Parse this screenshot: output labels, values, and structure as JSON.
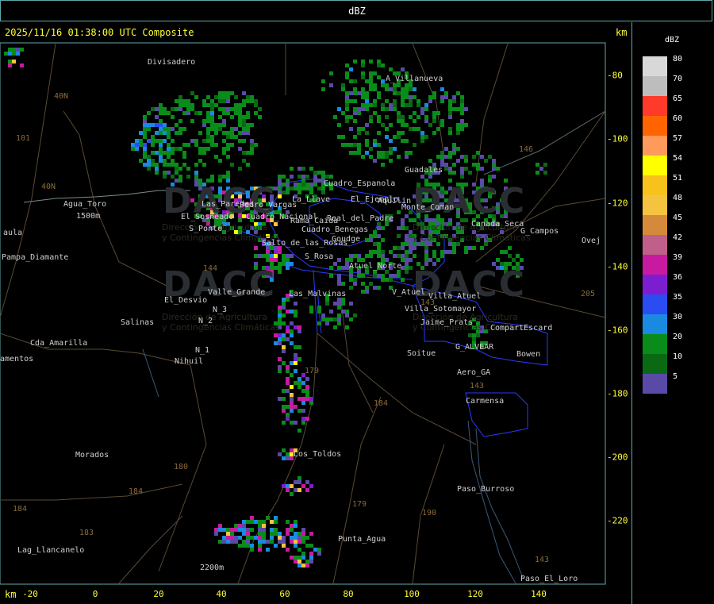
{
  "window": {
    "title": "dBZ"
  },
  "header": {
    "timestamp_label": "2025/11/16 01:38:00 UTC Composite",
    "unit_top": "km",
    "unit_bottom": "km"
  },
  "axes": {
    "x_ticks": [
      "-20",
      "0",
      "20",
      "40",
      "60",
      "80",
      "100",
      "120",
      "140"
    ],
    "y_ticks": [
      "-80",
      "-100",
      "-120",
      "-140",
      "-160",
      "-180",
      "-200",
      "-220"
    ]
  },
  "legend": {
    "title": "dBZ",
    "entries": [
      {
        "label": "80",
        "color": "#d8d8d8"
      },
      {
        "label": "70",
        "color": "#bdbdbd"
      },
      {
        "label": "65",
        "color": "#ff3a2a"
      },
      {
        "label": "60",
        "color": "#ff6400"
      },
      {
        "label": "57",
        "color": "#ff9a5a"
      },
      {
        "label": "54",
        "color": "#ffff00"
      },
      {
        "label": "51",
        "color": "#f8c21c"
      },
      {
        "label": "48",
        "color": "#f4c440"
      },
      {
        "label": "45",
        "color": "#d48a3a"
      },
      {
        "label": "42",
        "color": "#c0608a"
      },
      {
        "label": "39",
        "color": "#c81aa0"
      },
      {
        "label": "36",
        "color": "#7c1ed0"
      },
      {
        "label": "35",
        "color": "#2a4cf0"
      },
      {
        "label": "30",
        "color": "#1a8ae0"
      },
      {
        "label": "20",
        "color": "#0a8c1a"
      },
      {
        "label": "10",
        "color": "#0a6a14"
      },
      {
        "label": "5",
        "color": "#5a4aa8"
      }
    ]
  },
  "places": [
    {
      "label": "Divisadero"
    },
    {
      "label": "A_Villanueva"
    },
    {
      "label": "Guadales"
    },
    {
      "label": "Agua_Toro"
    },
    {
      "label": "1500m"
    },
    {
      "label": "aula"
    },
    {
      "label": "Pampa_Diamante"
    },
    {
      "label": "S_Ponte"
    },
    {
      "label": "S_Rosa"
    },
    {
      "label": "Valle_Grande"
    },
    {
      "label": "El_Desvio"
    },
    {
      "label": "Salinas"
    },
    {
      "label": "N_2"
    },
    {
      "label": "N_1"
    },
    {
      "label": "N_3"
    },
    {
      "label": "Nihuil"
    },
    {
      "label": "Cda_Amarilla"
    },
    {
      "label": "amentos"
    },
    {
      "label": "Morados"
    },
    {
      "label": "Lag_Llancanelo"
    },
    {
      "label": "2200m"
    },
    {
      "label": "Los_Toldos"
    },
    {
      "label": "Punta_Agua"
    },
    {
      "label": "Paso_Burroso"
    },
    {
      "label": "Paso_El_Loro"
    },
    {
      "label": "Carmensa"
    },
    {
      "label": "Bowen"
    },
    {
      "label": "Aero_GA"
    },
    {
      "label": "Soitue"
    },
    {
      "label": "G_ALVEAR"
    },
    {
      "label": "CompartEscard"
    },
    {
      "label": "V_Atuel"
    },
    {
      "label": "Atuel_Norte"
    },
    {
      "label": "G_Campos"
    },
    {
      "label": "Ovej"
    },
    {
      "label": "Jaime_Prats"
    },
    {
      "label": "Salto_de_las_Rosas"
    },
    {
      "label": "Cuadro_Benegas"
    },
    {
      "label": "Las_Malvinas"
    },
    {
      "label": "Rama_Caida"
    },
    {
      "label": "Cuadro_Nacional"
    },
    {
      "label": "Pedro_Vargas"
    },
    {
      "label": "Villa_Atuel"
    },
    {
      "label": "Monte_Coman"
    },
    {
      "label": "Real_del_Padre"
    },
    {
      "label": "Goudge"
    },
    {
      "label": "Canada_Seca"
    },
    {
      "label": "La_Llave"
    },
    {
      "label": "Cuadro_Espanola"
    },
    {
      "label": "Las_Paredes"
    },
    {
      "label": "El_Sosneado"
    },
    {
      "label": "El_Ejemplo"
    },
    {
      "label": "Aquilin"
    },
    {
      "label": "Villa_Sotomayor"
    }
  ],
  "routes": [
    {
      "label": "40N"
    },
    {
      "label": "40N"
    },
    {
      "label": "101"
    },
    {
      "label": "143"
    },
    {
      "label": "146"
    },
    {
      "label": "205"
    },
    {
      "label": "179"
    },
    {
      "label": "184"
    },
    {
      "label": "180"
    },
    {
      "label": "184"
    },
    {
      "label": "183"
    },
    {
      "label": "184"
    },
    {
      "label": "179"
    },
    {
      "label": "190"
    },
    {
      "label": "143"
    },
    {
      "label": "143"
    },
    {
      "label": "144"
    }
  ],
  "watermark": {
    "brand": "DACC",
    "subtitle_line1": "Dirección de Agricultura",
    "subtitle_line2": "y Contingencias Climáticas"
  }
}
